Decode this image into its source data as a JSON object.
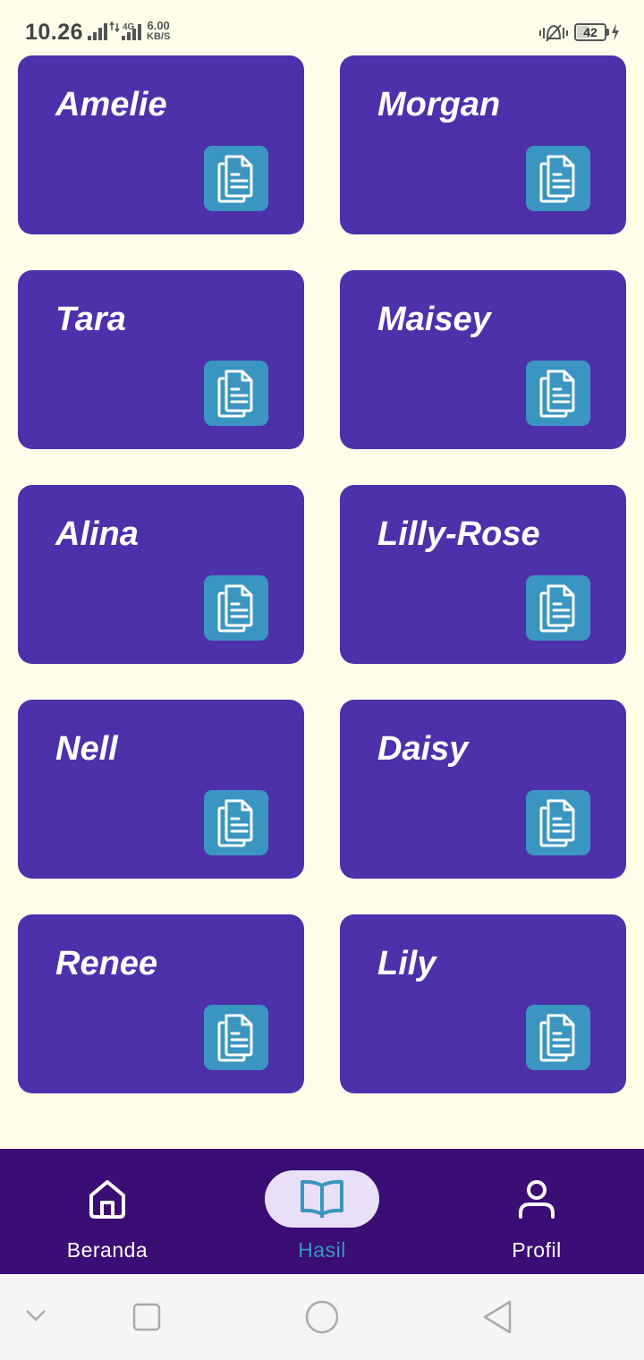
{
  "status_bar": {
    "time": "10.26",
    "network_type": "4G",
    "speed_value": "6.00",
    "speed_unit": "KB/S",
    "battery": "42"
  },
  "cards": [
    {
      "name": "Amelie",
      "icon": "document-icon"
    },
    {
      "name": "Morgan",
      "icon": "document-icon"
    },
    {
      "name": "Tara",
      "icon": "document-icon"
    },
    {
      "name": "Maisey",
      "icon": "document-icon"
    },
    {
      "name": "Alina",
      "icon": "document-icon"
    },
    {
      "name": "Lilly-Rose",
      "icon": "document-icon"
    },
    {
      "name": "Nell",
      "icon": "document-icon"
    },
    {
      "name": "Daisy",
      "icon": "document-icon"
    },
    {
      "name": "Renee",
      "icon": "document-icon"
    },
    {
      "name": "Lily",
      "icon": "document-icon"
    }
  ],
  "bottom_nav": {
    "items": [
      {
        "label": "Beranda",
        "icon": "home-icon",
        "active": false
      },
      {
        "label": "Hasil",
        "icon": "book-icon",
        "active": true
      },
      {
        "label": "Profil",
        "icon": "person-icon",
        "active": false
      }
    ]
  },
  "colors": {
    "background": "#FEFEEB",
    "card": "#4E30AA",
    "icon_button": "#3A95C0",
    "nav_bar": "#3A0E74",
    "nav_active_pill": "#E9E0F8",
    "nav_active_label": "#3A95C0"
  }
}
